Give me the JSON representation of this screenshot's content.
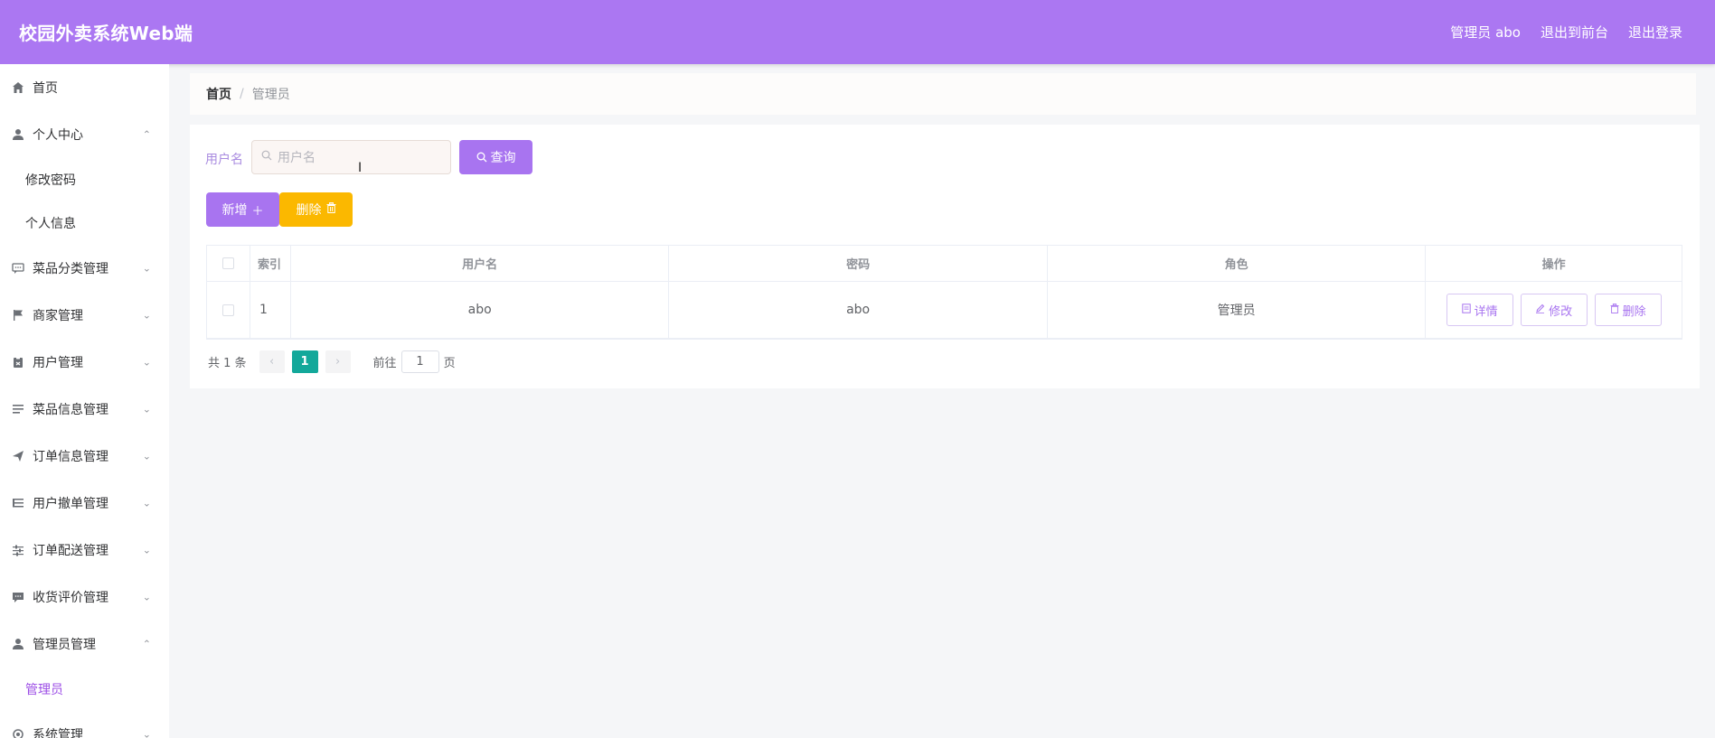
{
  "header": {
    "title": "校园外卖系统Web端",
    "user_label": "管理员 abo",
    "back_front": "退出到前台",
    "logout": "退出登录"
  },
  "sidebar": {
    "items": [
      {
        "label": "首页",
        "icon": "home-icon"
      },
      {
        "label": "个人中心",
        "icon": "user-icon",
        "expanded": true,
        "children": [
          "修改密码",
          "个人信息"
        ]
      },
      {
        "label": "菜品分类管理",
        "icon": "chat-icon"
      },
      {
        "label": "商家管理",
        "icon": "flag-icon"
      },
      {
        "label": "用户管理",
        "icon": "clipboard-icon"
      },
      {
        "label": "菜品信息管理",
        "icon": "list-icon"
      },
      {
        "label": "订单信息管理",
        "icon": "send-icon"
      },
      {
        "label": "用户撤单管理",
        "icon": "list-icon"
      },
      {
        "label": "订单配送管理",
        "icon": "sliders-icon"
      },
      {
        "label": "收货评价管理",
        "icon": "comment-icon"
      },
      {
        "label": "管理员管理",
        "icon": "user-icon",
        "expanded": true,
        "children": [
          "管理员"
        ]
      },
      {
        "label": "系统管理",
        "icon": "gear-icon"
      }
    ],
    "active_child": "管理员"
  },
  "breadcrumb": {
    "home": "首页",
    "separator": "/",
    "current": "管理员"
  },
  "search": {
    "label": "用户名",
    "placeholder": "用户名",
    "query_button": "查询"
  },
  "actions": {
    "add_label": "新增",
    "delete_label": "删除"
  },
  "table": {
    "columns": [
      "索引",
      "用户名",
      "密码",
      "角色",
      "操作"
    ],
    "rows": [
      {
        "index": "1",
        "username": "abo",
        "password": "abo",
        "role": "管理员"
      }
    ],
    "row_actions": {
      "detail": "详情",
      "edit": "修改",
      "delete": "删除"
    }
  },
  "pagination": {
    "total_text": "共 1 条",
    "current_page": "1",
    "goto_label": "前往",
    "goto_value": "1",
    "page_suffix": "页"
  },
  "colors": {
    "header_bg": "#ab77f2",
    "primary": "#a874f0",
    "danger": "#fbb800",
    "pager_active": "#13a89a"
  }
}
